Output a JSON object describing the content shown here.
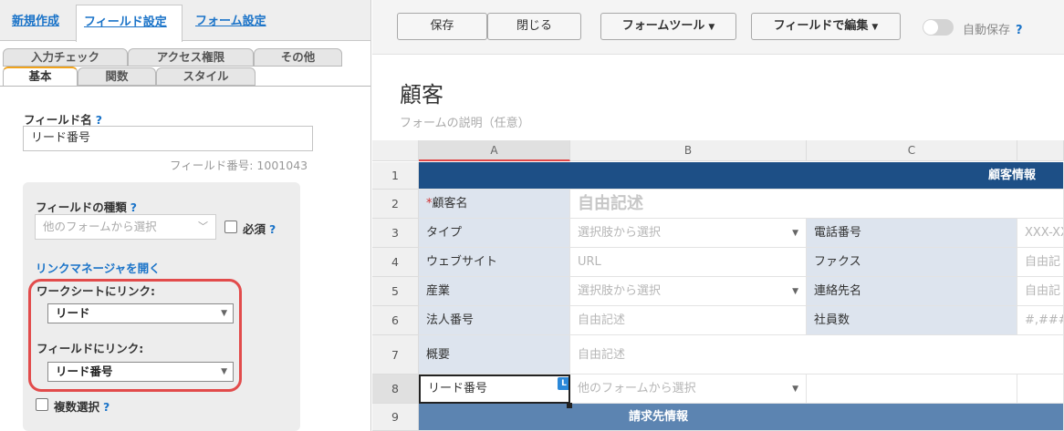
{
  "left_panel": {
    "top_tabs": [
      "新規作成",
      "フィールド設定",
      "フォーム設定"
    ],
    "sub_tabs_row1": [
      "入力チェック",
      "アクセス権限",
      "その他"
    ],
    "sub_tabs_row2": [
      "基本",
      "関数",
      "スタイル"
    ],
    "field_name_label": "フィールド名",
    "help": "?",
    "field_name_value": "リード番号",
    "field_number": "フィールド番号: 1001043",
    "field_type_label": "フィールドの種類",
    "field_type_value": "他のフォームから選択",
    "required_label": "必須",
    "link_manager": "リンクマネージャを開く",
    "worksheet_link_label": "ワークシートにリンク:",
    "worksheet_link_value": "リード",
    "field_link_label": "フィールドにリンク:",
    "field_link_value": "リード番号",
    "multi_select_label": "複数選択"
  },
  "toolbar": {
    "save": "保存",
    "close": "閉じる",
    "form_tools": "フォームツール",
    "edit_by_field": "フィールドで編集",
    "caret": "▼",
    "autosave": "自動保存",
    "help": "?"
  },
  "form": {
    "title": "顧客",
    "description": "フォームの説明（任意）"
  },
  "grid": {
    "columns": [
      "A",
      "B",
      "C"
    ],
    "rows": [
      "1",
      "2",
      "3",
      "4",
      "5",
      "6",
      "7",
      "8",
      "9"
    ],
    "banner1": "顧客情報",
    "banner2": "請求先情報",
    "r2": {
      "req": "*",
      "label": "顧客名",
      "value": "自由記述"
    },
    "r3": {
      "label": "タイプ",
      "value": "選択肢から選択",
      "label_c": "電話番号",
      "value_d": "XXX-XX"
    },
    "r4": {
      "label": "ウェブサイト",
      "value": "URL",
      "label_c": "ファクス",
      "value_d": "自由記"
    },
    "r5": {
      "label": "産業",
      "value": "選択肢から選択",
      "label_c": "連絡先名",
      "value_d": "自由記"
    },
    "r6": {
      "label": "法人番号",
      "value": "自由記述",
      "label_c": "社員数",
      "value_d": "#,###"
    },
    "r7": {
      "label": "概要",
      "value": "自由記述"
    },
    "r8": {
      "label": "リード番号",
      "value": "他のフォームから選択",
      "badge": "L"
    },
    "key_icon": "🔑"
  },
  "icons": {
    "chevron": "chevron-down-icon",
    "key": "key-icon",
    "link_badge": "link-icon"
  }
}
